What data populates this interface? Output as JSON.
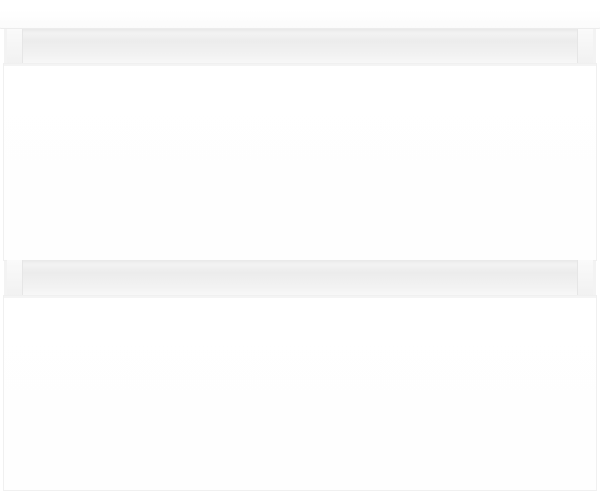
{
  "scene": {
    "subject": "wall-mounted-vanity-cabinet",
    "drawers": [
      {
        "position": "top"
      },
      {
        "position": "bottom"
      }
    ],
    "colors": {
      "background": "#ffffff",
      "cabinet": "#ffffff",
      "groove_shadow": "#ececec"
    }
  }
}
